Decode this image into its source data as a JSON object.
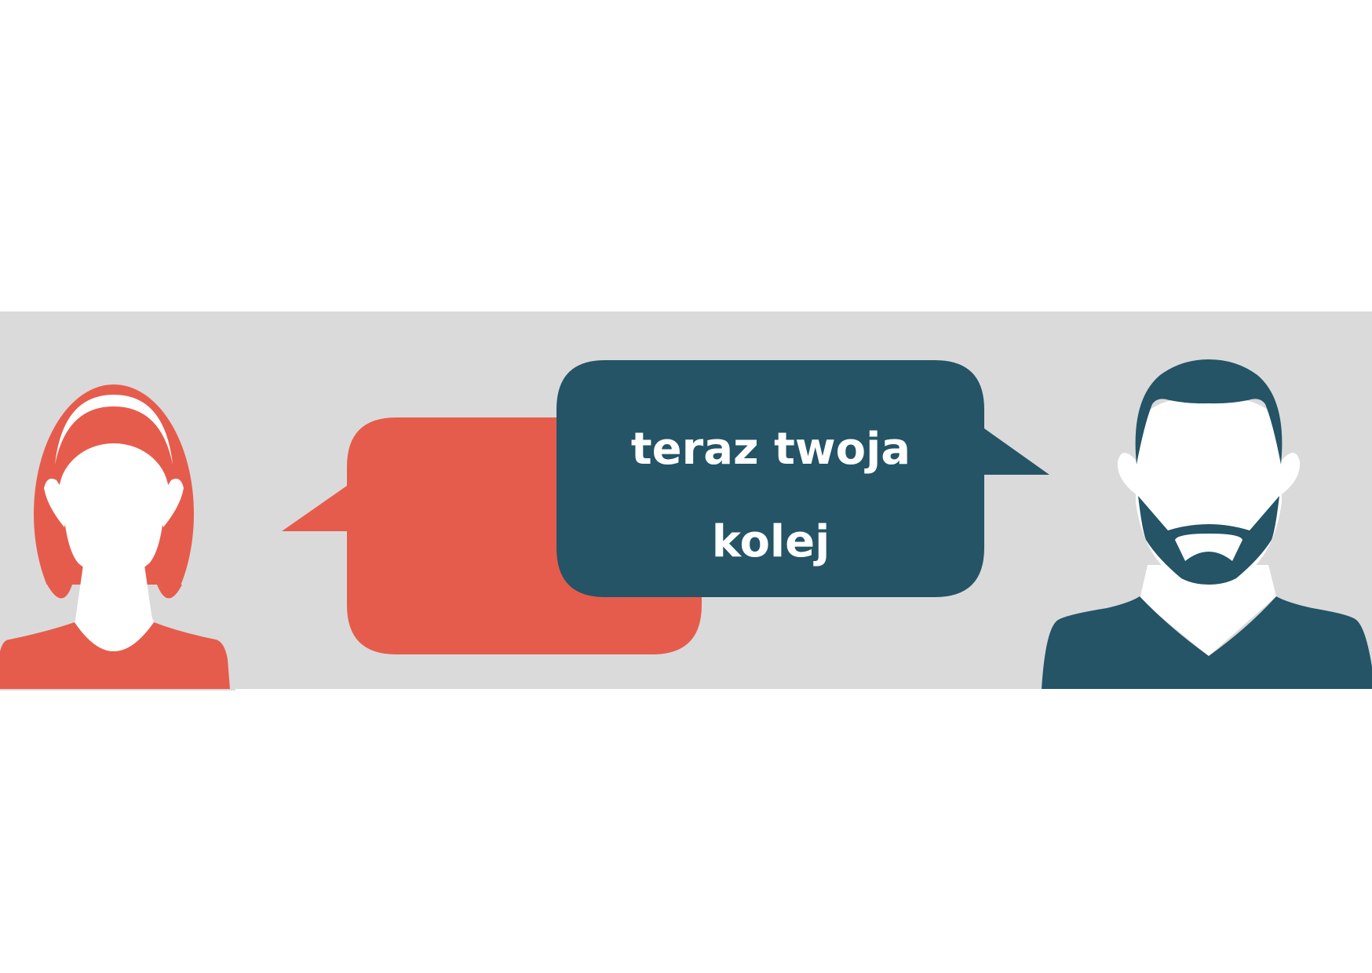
{
  "speech_bubble": {
    "text": "teraz twoja\nkolej"
  },
  "colors": {
    "page_background": "#ffffff",
    "band_background": "#dadada",
    "coral": "#e65c4c",
    "dark_teal": "#245466",
    "white": "#ffffff"
  },
  "figures": {
    "left": "woman-avatar-icon",
    "right": "bearded-man-avatar-icon"
  }
}
